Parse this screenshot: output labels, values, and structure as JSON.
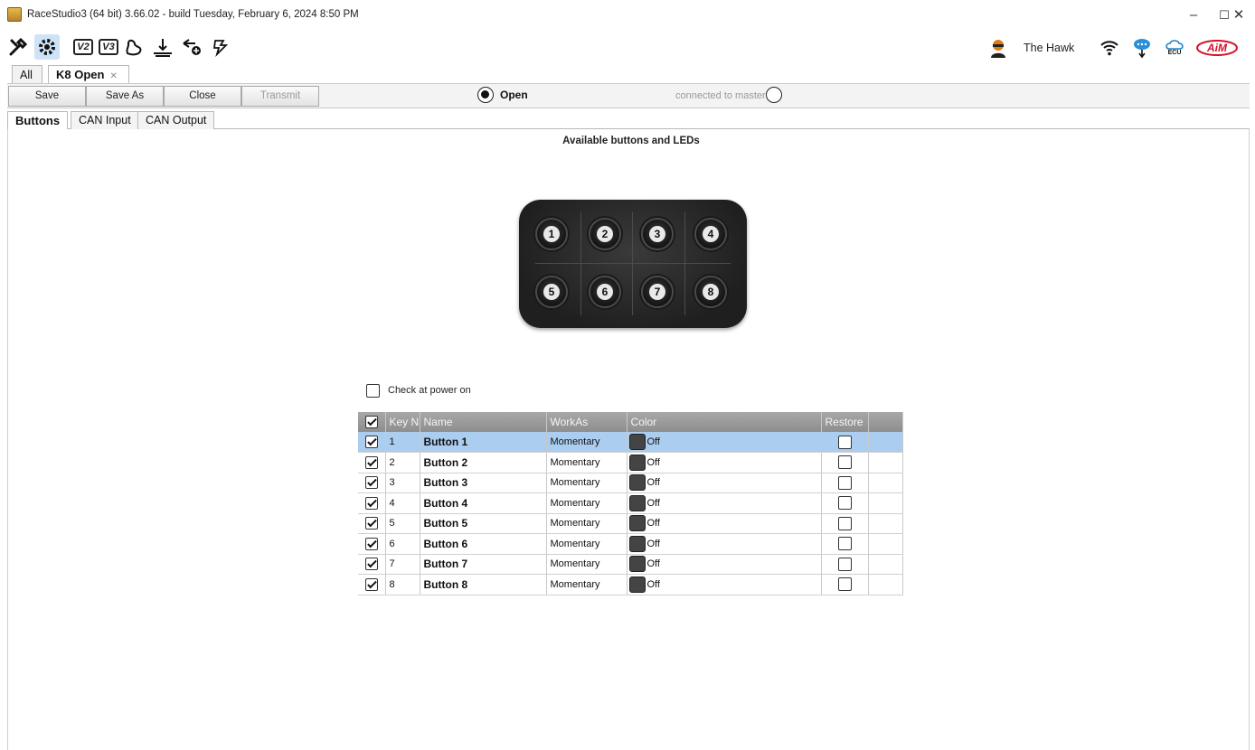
{
  "window": {
    "title": "RaceStudio3 (64 bit) 3.66.02 - build Tuesday, February 6, 2024 8:50 PM",
    "controls": [
      "–",
      "☐",
      "✕"
    ]
  },
  "toolbar": {
    "icons": [
      "tools-icon",
      "settings-gear-icon",
      "v2-icon",
      "v3-icon",
      "track-map-icon",
      "logger-download-icon",
      "add-wifi-icon",
      "live-measures-icon"
    ],
    "v2_label": "V2",
    "v3_label": "V3",
    "user_name": "The Hawk",
    "right_icons": [
      "wifi-icon",
      "cloud-ecu-icon",
      "ecu-icon",
      "aim-logo"
    ],
    "ecu_text": "ECU",
    "logo_text": "AiM"
  },
  "doc_tabs": [
    {
      "label": "All"
    },
    {
      "label": "K8 Open",
      "close": "✕"
    }
  ],
  "actions": {
    "save": "Save",
    "save_as": "Save As",
    "close": "Close",
    "transmit": "Transmit",
    "open_label": "Open",
    "connected_label": "connected to master"
  },
  "section_tabs": [
    "Buttons",
    "CAN Input",
    "CAN Output"
  ],
  "main": {
    "heading": "Available buttons and LEDs",
    "check_power_on": "Check at power on"
  },
  "keypad": {
    "keys": [
      "1",
      "2",
      "3",
      "4",
      "5",
      "6",
      "7",
      "8"
    ]
  },
  "table": {
    "columns": [
      "",
      "Key N",
      "Name",
      "WorkAs",
      "Color",
      "Restore",
      ""
    ],
    "rows": [
      {
        "key": "1",
        "name": "Button 1",
        "work_as": "Momentary",
        "color": "Off",
        "selected": true
      },
      {
        "key": "2",
        "name": "Button 2",
        "work_as": "Momentary",
        "color": "Off"
      },
      {
        "key": "3",
        "name": "Button 3",
        "work_as": "Momentary",
        "color": "Off"
      },
      {
        "key": "4",
        "name": "Button 4",
        "work_as": "Momentary",
        "color": "Off"
      },
      {
        "key": "5",
        "name": "Button 5",
        "work_as": "Momentary",
        "color": "Off"
      },
      {
        "key": "6",
        "name": "Button 6",
        "work_as": "Momentary",
        "color": "Off"
      },
      {
        "key": "7",
        "name": "Button 7",
        "work_as": "Momentary",
        "color": "Off"
      },
      {
        "key": "8",
        "name": "Button 8",
        "work_as": "Momentary",
        "color": "Off"
      }
    ]
  },
  "colors": {
    "selected_row": "#abcdf0",
    "header_bg": "#9a9a9a",
    "logo_red": "#d4102a"
  }
}
